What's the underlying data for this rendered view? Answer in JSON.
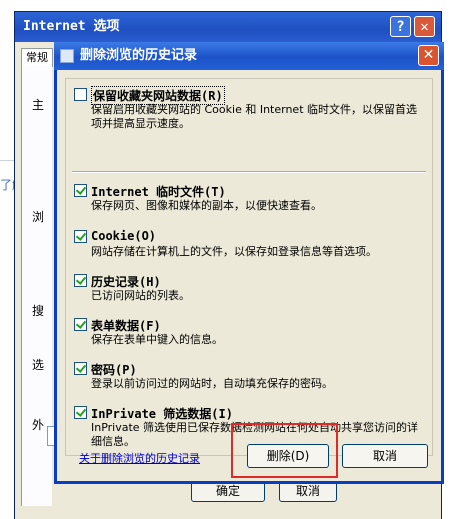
{
  "outer_window": {
    "title": "Internet 选项",
    "help_button": "?",
    "close_button": "✕",
    "tab_label": "常规",
    "side_labels": [
      "主",
      "浏",
      "搜",
      "选",
      "外"
    ],
    "ok_label": "确定",
    "cancel_label": "取消"
  },
  "background": {
    "side_link": "了解"
  },
  "dialog": {
    "title": "删除浏览的历史记录",
    "close_button": "✕",
    "options": [
      {
        "title": "保留收藏夹网站数据(R)",
        "desc": "保留启用收藏夹网站的 Cookie 和 Internet 临时文件，以保留首选项并提高显示速度。",
        "checked": false
      },
      {
        "title": "Internet 临时文件(T)",
        "desc": "保存网页、图像和媒体的副本，以便快速查看。",
        "checked": true
      },
      {
        "title": "Cookie(O)",
        "desc": "网站存储在计算机上的文件，以保存如登录信息等首选项。",
        "checked": true
      },
      {
        "title": "历史记录(H)",
        "desc": "已访问网站的列表。",
        "checked": true
      },
      {
        "title": "表单数据(F)",
        "desc": "保存在表单中键入的信息。",
        "checked": true
      },
      {
        "title": "密码(P)",
        "desc": "登录以前访问过的网站时，自动填充保存的密码。",
        "checked": true
      },
      {
        "title": "InPrivate 筛选数据(I)",
        "desc": "InPrivate 筛选使用已保存数据检测网站在何处自动共享您访问的详细信息。",
        "checked": true
      }
    ],
    "help_link": "关于删除浏览的历史记录",
    "delete_button": "删除(D)",
    "cancel_button": "取消"
  },
  "colors": {
    "title_bar": "#2461d8",
    "highlight": "#e02a2a",
    "link": "#0000cc"
  }
}
